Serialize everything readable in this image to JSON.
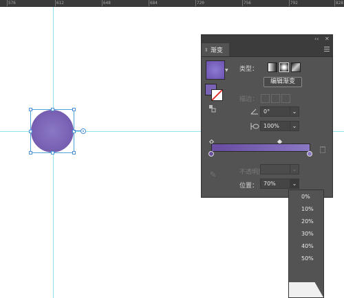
{
  "ruler": {
    "labels": [
      "576",
      "612",
      "648",
      "684",
      "720",
      "756",
      "792",
      "828"
    ]
  },
  "panel": {
    "header_controls": [
      "‹‹",
      "✕"
    ],
    "tab_title": "渐变",
    "tab_toggle": "⇕",
    "type_label": "类型：",
    "edit_gradient_label": "编辑渐变",
    "stroke_label": "描边：",
    "angle_value": "0°",
    "aspect_value": "100%",
    "opacity_label": "不透明度：",
    "opacity_value": "",
    "location_label": "位置：",
    "location_value": "70%",
    "dropdown_caret": "⌄"
  },
  "location_menu": {
    "options": [
      "0%",
      "10%",
      "20%",
      "30%",
      "40%",
      "50%"
    ]
  },
  "colors": {
    "gradient_start": "#6a4fa3",
    "gradient_end": "#8a78c4",
    "guide": "#8fe3ee",
    "panel_bg": "#535353"
  },
  "icons": {
    "type_linear": "linear-gradient-icon",
    "type_radial": "radial-gradient-icon",
    "type_freeform": "freeform-gradient-icon",
    "angle": "angle-icon",
    "aspect": "aspect-ratio-icon",
    "eyedropper": "eyedropper-icon",
    "trash": "trash-icon"
  }
}
